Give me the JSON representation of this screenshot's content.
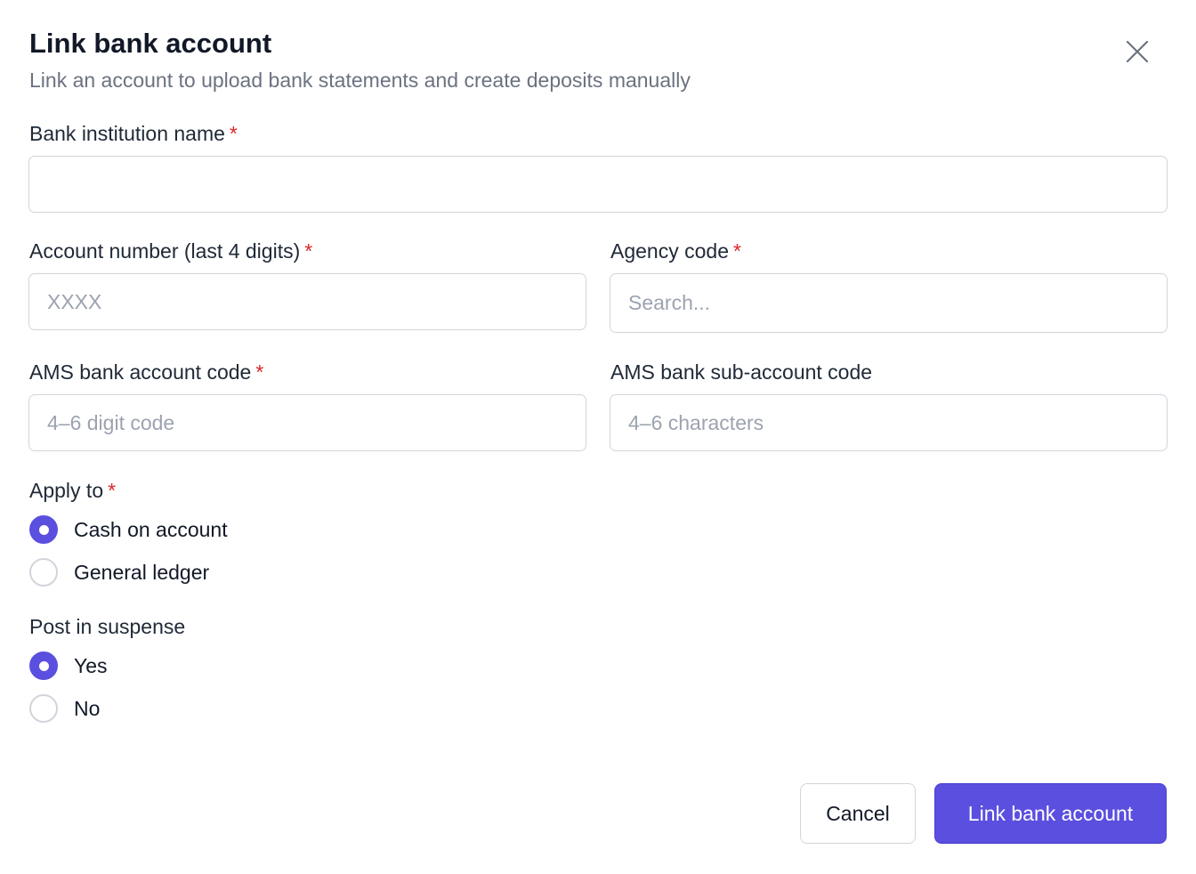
{
  "dialog": {
    "title": "Link bank account",
    "subtitle": "Link an account to upload bank statements and create deposits manually"
  },
  "fields": {
    "bank_institution_name": {
      "label": "Bank institution name",
      "required_mark": "*",
      "value": "",
      "placeholder": ""
    },
    "account_number": {
      "label": "Account number (last 4 digits)",
      "required_mark": "*",
      "value": "",
      "placeholder": "XXXX"
    },
    "agency_code": {
      "label": "Agency code",
      "required_mark": "*",
      "value": "",
      "placeholder": "Search..."
    },
    "ams_bank_account_code": {
      "label": "AMS bank account code",
      "required_mark": "*",
      "value": "",
      "placeholder": "4–6 digit code"
    },
    "ams_bank_sub_account_code": {
      "label": "AMS bank sub-account code",
      "value": "",
      "placeholder": "4–6 characters"
    }
  },
  "apply_to": {
    "label": "Apply to",
    "required_mark": "*",
    "options": [
      {
        "label": "Cash on account",
        "selected": true
      },
      {
        "label": "General ledger",
        "selected": false
      }
    ]
  },
  "post_in_suspense": {
    "label": "Post in suspense",
    "options": [
      {
        "label": "Yes",
        "selected": true
      },
      {
        "label": "No",
        "selected": false
      }
    ]
  },
  "actions": {
    "cancel_label": "Cancel",
    "submit_label": "Link bank account"
  },
  "colors": {
    "accent": "#5b4fe0",
    "required": "#dc2626",
    "border": "#d1d5db",
    "muted_text": "#6b7280"
  },
  "icons": {
    "close": "close-icon",
    "radio_selected": "radio-checked-icon"
  }
}
